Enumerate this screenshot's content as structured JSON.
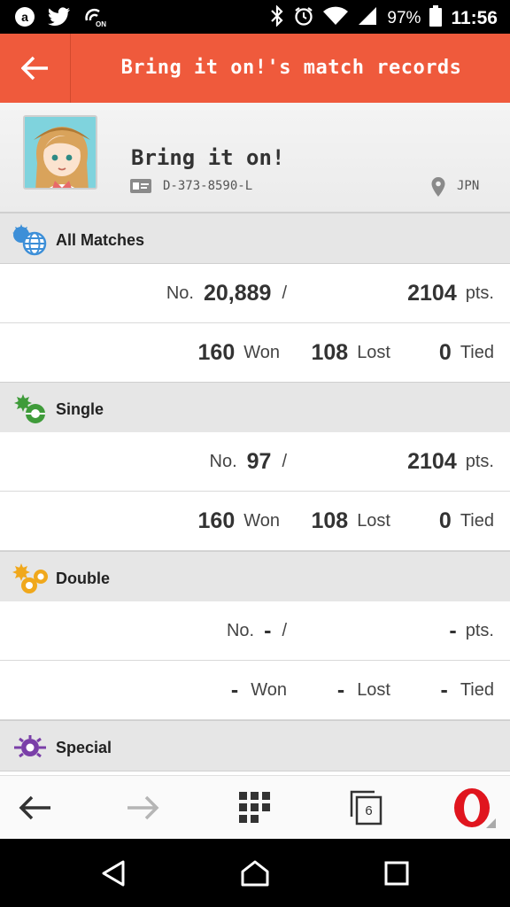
{
  "status_bar": {
    "battery": "97%",
    "time": "11:56",
    "left_icons": [
      "app-notification-icon",
      "twitter-icon",
      "nfc-icon"
    ],
    "right_icons": [
      "bluetooth-icon",
      "alarm-icon",
      "wifi-icon",
      "signal-icon",
      "battery-icon"
    ]
  },
  "header": {
    "title": "Bring it on!'s match records"
  },
  "profile": {
    "name": "Bring it on!",
    "id": "D-373-8590-L",
    "region": "JPN"
  },
  "sections": {
    "all": {
      "label": "All Matches",
      "rank_prefix": "No.",
      "rank": "20,889",
      "sep": "/",
      "points": "2104",
      "points_unit": "pts.",
      "won": "160",
      "won_label": "Won",
      "lost": "108",
      "lost_label": "Lost",
      "tied": "0",
      "tied_label": "Tied"
    },
    "single": {
      "label": "Single",
      "rank_prefix": "No.",
      "rank": "97",
      "sep": "/",
      "points": "2104",
      "points_unit": "pts.",
      "won": "160",
      "won_label": "Won",
      "lost": "108",
      "lost_label": "Lost",
      "tied": "0",
      "tied_label": "Tied"
    },
    "double": {
      "label": "Double",
      "rank_prefix": "No.",
      "rank": "-",
      "sep": "/",
      "points": "-",
      "points_unit": "pts.",
      "won": "-",
      "won_label": "Won",
      "lost": "-",
      "lost_label": "Lost",
      "tied": "-",
      "tied_label": "Tied"
    },
    "special": {
      "label": "Special"
    }
  },
  "toolbar": {
    "tabs_count": "6"
  },
  "colors": {
    "header": "#ef5a3c",
    "section_bg": "#e6e6e6",
    "opera_red": "#e0151e"
  }
}
